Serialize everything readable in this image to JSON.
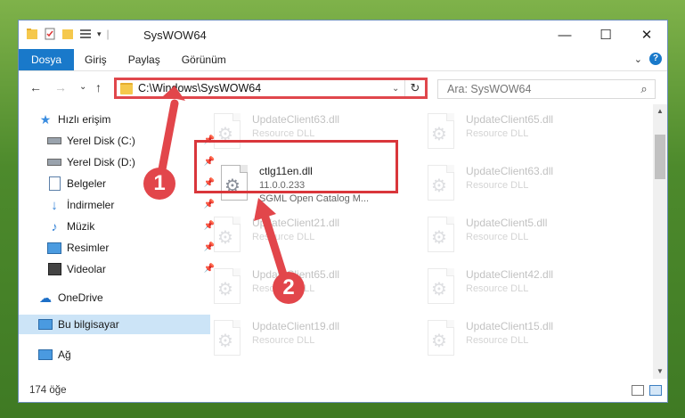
{
  "window": {
    "title": "SysWOW64",
    "minimize": "—",
    "maximize": "☐",
    "close": "✕"
  },
  "ribbon": {
    "tabs": [
      "Dosya",
      "Giriş",
      "Paylaş",
      "Görünüm"
    ],
    "collapse": "⌄",
    "help": "?"
  },
  "nav": {
    "back": "←",
    "forward": "→",
    "recent": "⌄",
    "up": "↑",
    "address": "C:\\Windows\\SysWOW64",
    "address_drop": "⌄",
    "refresh": "↻",
    "search_placeholder": "Ara: SysWOW64"
  },
  "sidebar": {
    "quick_access": "Hızlı erişim",
    "items": [
      {
        "label": "Yerel Disk (C:)",
        "pinned": true
      },
      {
        "label": "Yerel Disk (D:)",
        "pinned": true
      },
      {
        "label": "Belgeler",
        "pinned": true
      },
      {
        "label": "İndirmeler",
        "pinned": true
      },
      {
        "label": "Müzik",
        "pinned": true
      },
      {
        "label": "Resimler",
        "pinned": true
      },
      {
        "label": "Videolar",
        "pinned": true
      }
    ],
    "onedrive": "OneDrive",
    "this_pc": "Bu bilgisayar",
    "network": "Ağ"
  },
  "files": {
    "left": [
      {
        "name": "UpdateClient63.dll",
        "type": "Resource DLL"
      },
      {
        "name": "UpdateClient21.dll",
        "type": "Resource DLL"
      },
      {
        "name": "UpdateClient65.dll",
        "type": "Resource DLL"
      },
      {
        "name": "UpdateClient19.dll",
        "type": "Resource DLL"
      }
    ],
    "right": [
      {
        "name": "UpdateClient65.dll",
        "type": "Resource DLL"
      },
      {
        "name": "UpdateClient63.dll",
        "type": "Resource DLL"
      },
      {
        "name": "UpdateClient5.dll",
        "type": "Resource DLL"
      },
      {
        "name": "UpdateClient42.dll",
        "type": "Resource DLL"
      },
      {
        "name": "UpdateClient15.dll",
        "type": "Resource DLL"
      }
    ],
    "focused": {
      "name": "ctlg11en.dll",
      "version": "11.0.0.233",
      "description": "SGML Open Catalog M..."
    }
  },
  "status": {
    "count": "174 öğe"
  },
  "callouts": [
    "1",
    "2"
  ],
  "colors": {
    "accent": "#1979ca",
    "annotation": "#e2464b"
  }
}
